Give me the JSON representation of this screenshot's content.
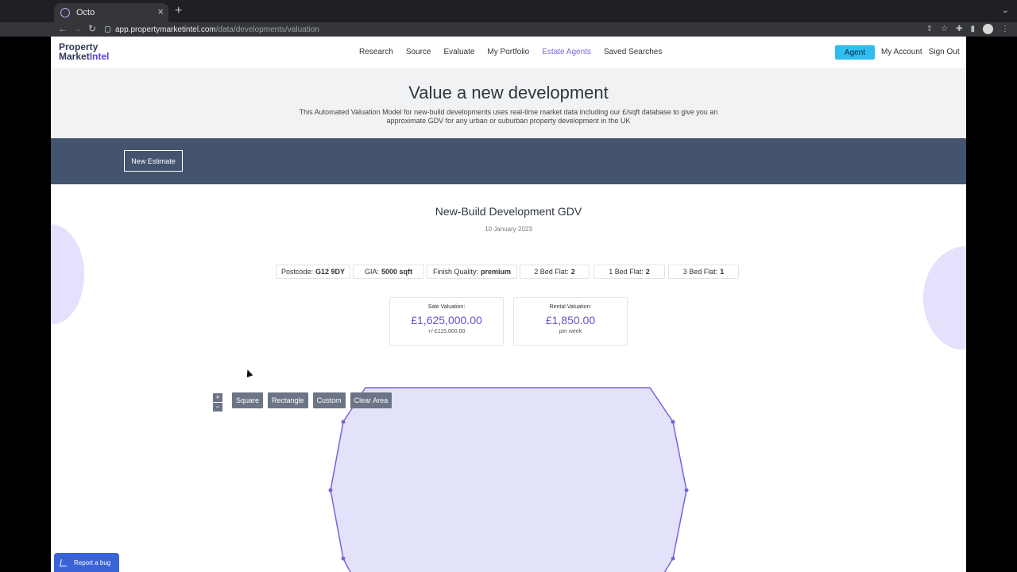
{
  "browser": {
    "tab_title": "Octo",
    "url_host": "app.propertymarketintel.com",
    "url_path": "/data/developments/valuation"
  },
  "header": {
    "logo_line1": "Property",
    "logo_line2_a": "Market",
    "logo_line2_b": "Intel",
    "nav": [
      "Research",
      "Source",
      "Evaluate",
      "My Portfolio",
      "Estate Agents",
      "Saved Searches"
    ],
    "agent_label": "Agent",
    "my_account": "My Account",
    "sign_out": "Sign Out"
  },
  "hero": {
    "title": "Value a new development",
    "description": "This Automated Valuation Model for new-build developments uses real-time market data including our £/sqft database to give you an approximate GDV for any urban or suburban property development in the UK"
  },
  "band": {
    "new_estimate": "New Estimate"
  },
  "result": {
    "title": "New-Build Development GDV",
    "date": "10 January 2023",
    "chips": [
      {
        "label": "Postcode:",
        "value": "G12 9DY"
      },
      {
        "label": "GIA:",
        "value": "5000 sqft"
      },
      {
        "label": "Finish Quality:",
        "value": "premium"
      },
      {
        "label": "2 Bed Flat:",
        "value": "2"
      },
      {
        "label": "1 Bed Flat:",
        "value": "2"
      },
      {
        "label": "3 Bed Flat:",
        "value": "1"
      }
    ],
    "sale": {
      "label": "Sale Valuation:",
      "amount": "£1,625,000.00",
      "sub": "+/-£115,000.00"
    },
    "rental": {
      "label": "Rental Valuation:",
      "amount": "£1,850.00",
      "sub": "per week"
    }
  },
  "map": {
    "zoom_in": "+",
    "zoom_out": "−",
    "tools": [
      "Square",
      "Rectangle",
      "Custom",
      "Clear Area"
    ],
    "polygon_fill": "#e3e2fb",
    "polygon_stroke": "#7a63d6"
  },
  "report_bug": "Report a bug"
}
